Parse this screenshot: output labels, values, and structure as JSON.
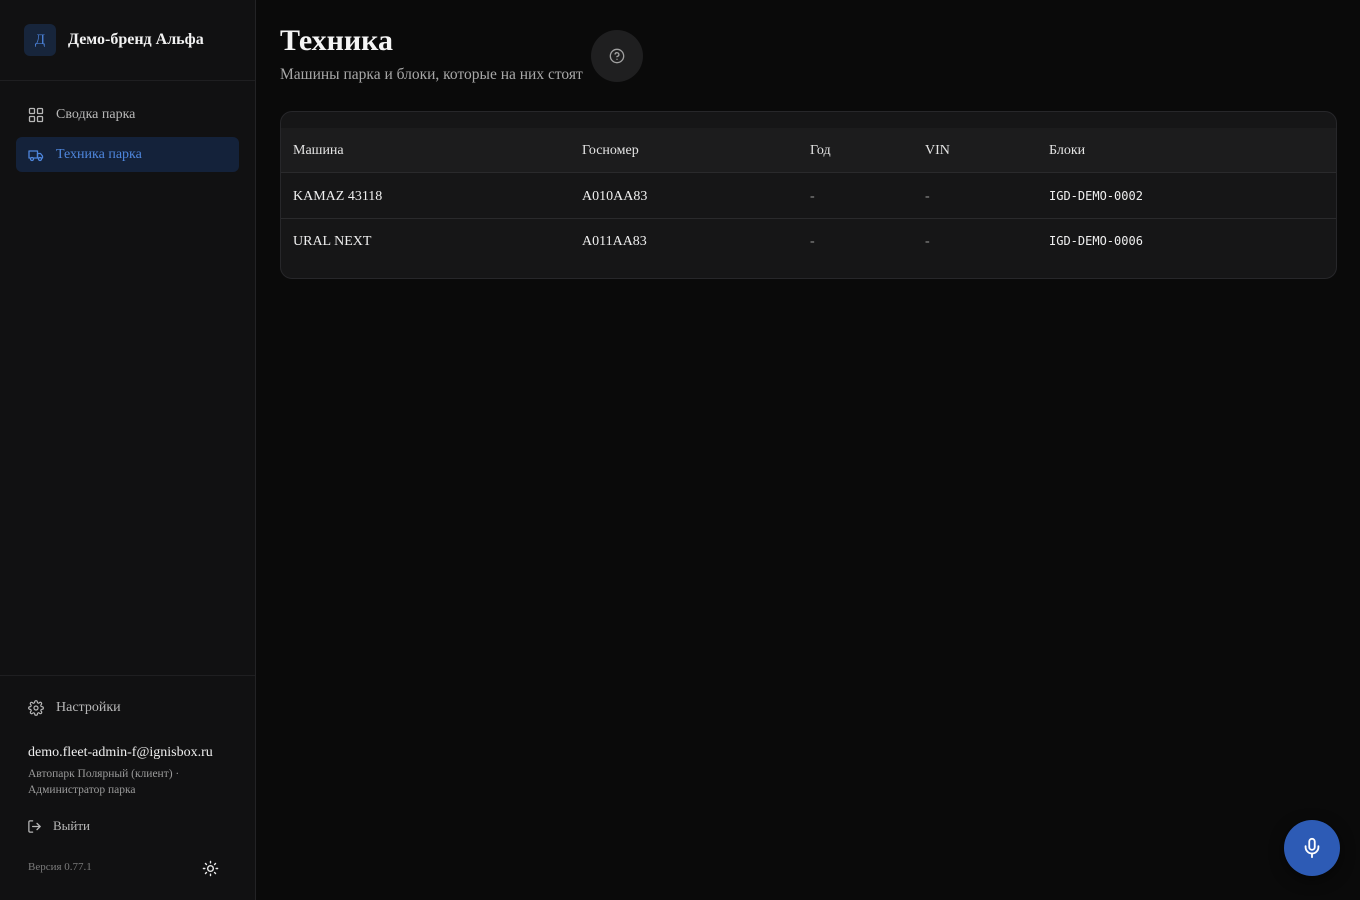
{
  "brand": {
    "badge": "Д",
    "name": "Демо-бренд Альфа"
  },
  "nav": {
    "items": [
      {
        "label": "Сводка парка",
        "icon": "dashboard-icon",
        "active": false
      },
      {
        "label": "Техника парка",
        "icon": "truck-icon",
        "active": true
      }
    ]
  },
  "sidebar_footer": {
    "settings_label": "Настройки",
    "user_email": "demo.fleet-admin-f@ignisbox.ru",
    "user_meta": "Автопарк Полярный (клиент) · Администратор парка",
    "logout_label": "Выйти",
    "version": "Версия 0.77.1"
  },
  "page": {
    "title": "Техника",
    "subtitle": "Машины парка и блоки, которые на них стоят"
  },
  "table": {
    "headers": [
      "Машина",
      "Госномер",
      "Год",
      "VIN",
      "Блоки"
    ],
    "rows": [
      [
        "KAMAZ 43118",
        "А010АА83",
        "-",
        "-",
        "IGD-DEMO-0002"
      ],
      [
        "URAL NEXT",
        "А011АА83",
        "-",
        "-",
        "IGD-DEMO-0006"
      ]
    ]
  },
  "colors": {
    "accent": "#4e86dc",
    "mic_button": "#2d5bb5",
    "background": "#0a0a0a"
  }
}
